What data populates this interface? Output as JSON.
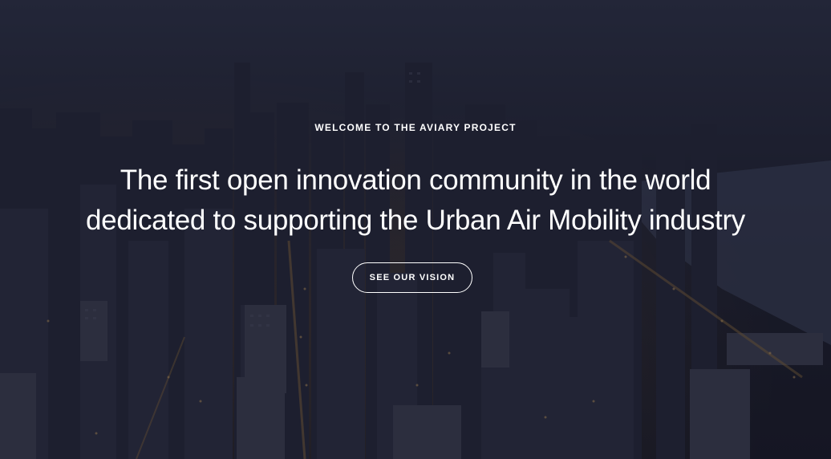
{
  "hero": {
    "eyebrow": "WELCOME TO THE AVIARY PROJECT",
    "headline_line1": "The first open innovation community in the world",
    "headline_line2": "dedicated to supporting the Urban Air Mobility industry",
    "cta_label": "SEE OUR VISION"
  },
  "colors": {
    "text": "#ffffff",
    "overlay": "#14142380"
  }
}
